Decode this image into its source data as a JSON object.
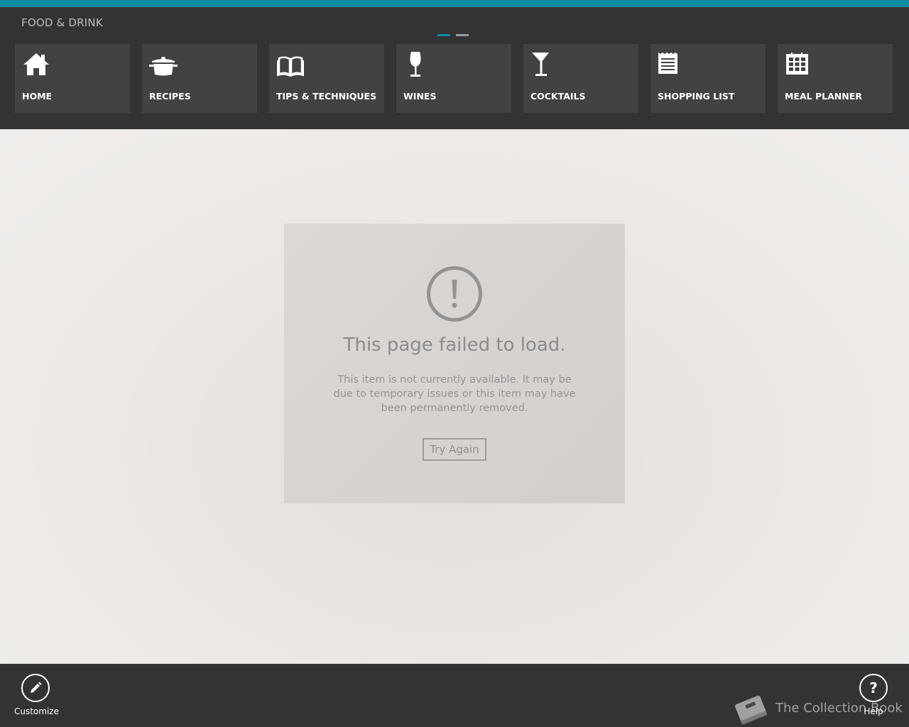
{
  "app": {
    "title": "FOOD & DRINK",
    "accent_color": "#0f8ba3",
    "page_indicator": {
      "pages": 2,
      "current": 1
    }
  },
  "nav": {
    "tiles": [
      {
        "label": "HOME",
        "icon": "home-icon"
      },
      {
        "label": "RECIPES",
        "icon": "pot-icon"
      },
      {
        "label": "TIPS & TECHNIQUES",
        "icon": "book-icon"
      },
      {
        "label": "WINES",
        "icon": "wine-glass-icon"
      },
      {
        "label": "COCKTAILS",
        "icon": "cocktail-glass-icon"
      },
      {
        "label": "SHOPPING LIST",
        "icon": "list-icon"
      },
      {
        "label": "MEAL PLANNER",
        "icon": "calendar-grid-icon"
      }
    ]
  },
  "error": {
    "icon": "exclamation-circle-icon",
    "title": "This page failed to load.",
    "message": "This item is not currently available. It may be due to temporary issues or this item may have been permanently removed.",
    "button_label": "Try Again"
  },
  "appbar": {
    "customize_label": "Customize",
    "customize_icon": "pencil-icon",
    "help_label": "Help",
    "help_icon": "question-icon",
    "help_glyph": "?"
  },
  "brand": {
    "name": "The Collection Book",
    "icon": "book-icon"
  }
}
